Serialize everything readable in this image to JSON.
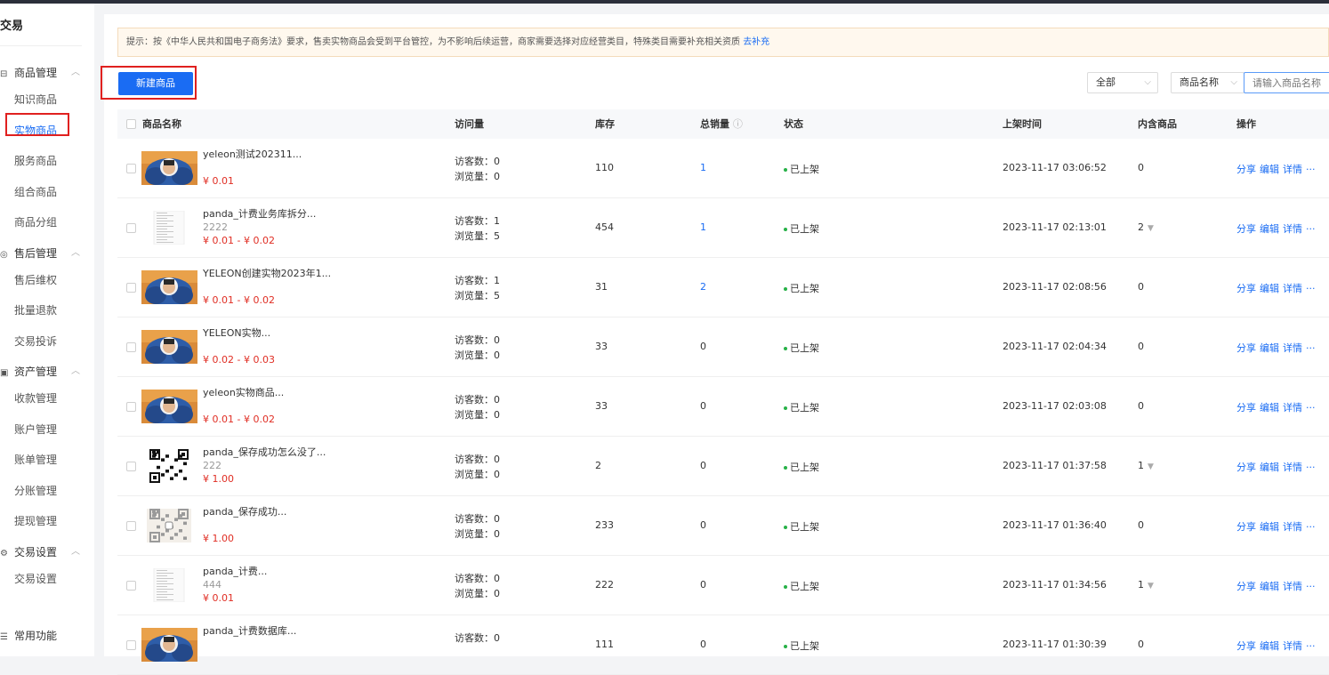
{
  "sidebar": {
    "title": "交易",
    "groups": [
      {
        "icon": "box-icon",
        "label": "商品管理",
        "items": [
          "知识商品",
          "实物商品",
          "服务商品",
          "组合商品",
          "商品分组"
        ]
      },
      {
        "icon": "headset-icon",
        "label": "售后管理",
        "items": [
          "售后维权",
          "批量退款",
          "交易投诉"
        ]
      },
      {
        "icon": "wallet-icon",
        "label": "资产管理",
        "items": [
          "收款管理",
          "账户管理",
          "账单管理",
          "分账管理",
          "提现管理"
        ]
      },
      {
        "icon": "settings-icon",
        "label": "交易设置",
        "items": [
          "交易设置"
        ]
      }
    ],
    "common": "常用功能",
    "active_item": "实物商品"
  },
  "notice": {
    "text": "提示：按《中华人民共和国电子商务法》要求，售卖实物商品会受到平台管控，为不影响后续运营，商家需要选择对应经营类目，特殊类目需要补充相关资质",
    "link": "去补充"
  },
  "toolbar": {
    "new_button": "新建商品",
    "status_select": "全部",
    "field_select": "商品名称",
    "search_placeholder": "请输入商品名称"
  },
  "table": {
    "headers": {
      "name": "商品名称",
      "visits": "访问量",
      "stock": "库存",
      "sales": "总销量",
      "status": "状态",
      "time": "上架时间",
      "contains": "内含商品",
      "ops": "操作"
    },
    "visitors_prefix": "访客数：",
    "views_prefix": "浏览量：",
    "ops": [
      "分享",
      "编辑",
      "详情",
      "···"
    ],
    "rows": [
      {
        "thumb": "photo",
        "name": "yeleon测试202311...",
        "sub": "",
        "price": "¥ 0.01",
        "visitors": "0",
        "views": "0",
        "stock": "110",
        "sales": "1",
        "sales_link": true,
        "status": "已上架",
        "time": "2023-11-17 03:06:52",
        "contains": "0",
        "contains_caret": false
      },
      {
        "thumb": "doc",
        "name": "panda_计费业务库拆分...",
        "sub": "2222",
        "price": "¥ 0.01 - ¥ 0.02",
        "visitors": "1",
        "views": "5",
        "stock": "454",
        "sales": "1",
        "sales_link": true,
        "status": "已上架",
        "time": "2023-11-17 02:13:01",
        "contains": "2",
        "contains_caret": true
      },
      {
        "thumb": "photo",
        "name": "YELEON创建实物2023年1...",
        "sub": "",
        "price": "¥ 0.01 - ¥ 0.02",
        "visitors": "1",
        "views": "5",
        "stock": "31",
        "sales": "2",
        "sales_link": true,
        "status": "已上架",
        "time": "2023-11-17 02:08:56",
        "contains": "0",
        "contains_caret": false
      },
      {
        "thumb": "photo",
        "name": "YELEON实物...",
        "sub": "",
        "price": "¥ 0.02 - ¥ 0.03",
        "visitors": "0",
        "views": "0",
        "stock": "33",
        "sales": "0",
        "sales_link": false,
        "status": "已上架",
        "time": "2023-11-17 02:04:34",
        "contains": "0",
        "contains_caret": false
      },
      {
        "thumb": "photo",
        "name": "yeleon实物商品...",
        "sub": "",
        "price": "¥ 0.01 - ¥ 0.02",
        "visitors": "0",
        "views": "0",
        "stock": "33",
        "sales": "0",
        "sales_link": false,
        "status": "已上架",
        "time": "2023-11-17 02:03:08",
        "contains": "0",
        "contains_caret": false
      },
      {
        "thumb": "qr",
        "name": "panda_保存成功怎么没了...",
        "sub": "222",
        "price": "¥ 1.00",
        "visitors": "0",
        "views": "0",
        "stock": "2",
        "sales": "0",
        "sales_link": false,
        "status": "已上架",
        "time": "2023-11-17 01:37:58",
        "contains": "1",
        "contains_caret": true
      },
      {
        "thumb": "qr-light",
        "name": "panda_保存成功...",
        "sub": "",
        "price": "¥ 1.00",
        "visitors": "0",
        "views": "0",
        "stock": "233",
        "sales": "0",
        "sales_link": false,
        "status": "已上架",
        "time": "2023-11-17 01:36:40",
        "contains": "0",
        "contains_caret": false
      },
      {
        "thumb": "doc",
        "name": "panda_计费...",
        "sub": "444",
        "price": "¥ 0.01",
        "visitors": "0",
        "views": "0",
        "stock": "222",
        "sales": "0",
        "sales_link": false,
        "status": "已上架",
        "time": "2023-11-17 01:34:56",
        "contains": "1",
        "contains_caret": true
      },
      {
        "thumb": "photo",
        "name": "panda_计费数据库...",
        "sub": "",
        "price": "",
        "visitors": "0",
        "views": "",
        "stock": "111",
        "sales": "0",
        "sales_link": false,
        "status": "已上架",
        "time": "2023-11-17 01:30:39",
        "contains": "0",
        "contains_caret": false
      }
    ]
  },
  "colors": {
    "primary": "#1a6cf3",
    "price": "#e02e24",
    "status_dot": "#27b148",
    "highlight_box": "#e0201f"
  }
}
